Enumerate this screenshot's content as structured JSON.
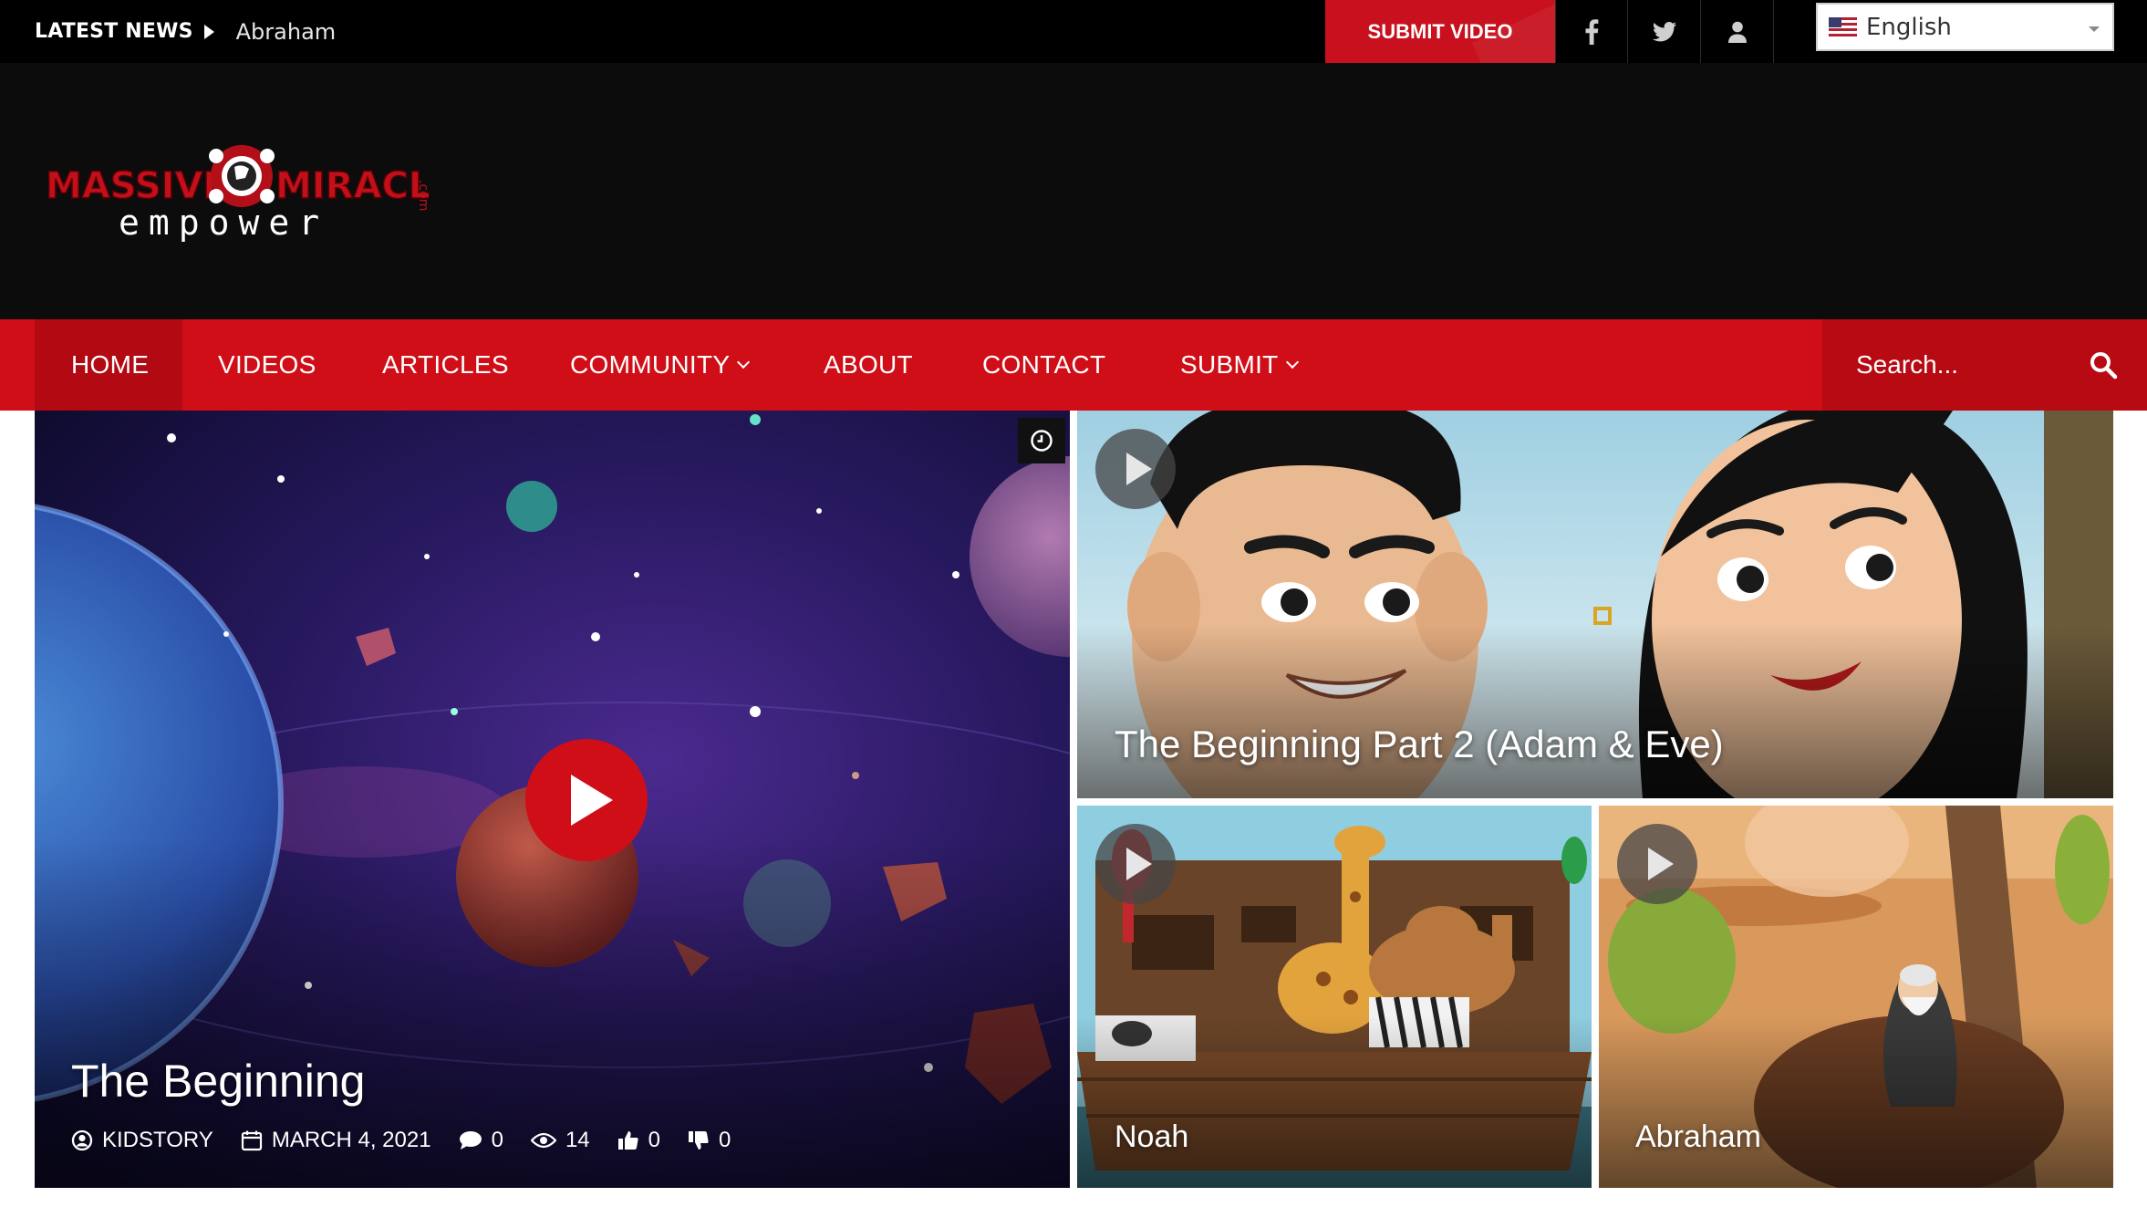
{
  "topbar": {
    "latest_label": "LATEST NEWS",
    "latest_item": "Abraham",
    "submit_video": "SUBMIT VIDEO",
    "social": [
      "facebook-icon",
      "twitter-icon",
      "user-icon"
    ],
    "language": "English"
  },
  "logo": {
    "word_left": "MASSIVE",
    "word_right": "MIRACLE",
    "tld": ".com",
    "tagline": "empower"
  },
  "nav": {
    "items": [
      {
        "label": "HOME",
        "active": true
      },
      {
        "label": "VIDEOS"
      },
      {
        "label": "ARTICLES"
      },
      {
        "label": "COMMUNITY",
        "dropdown": true
      },
      {
        "label": "ABOUT"
      },
      {
        "label": "CONTACT"
      },
      {
        "label": "SUBMIT",
        "dropdown": true
      }
    ],
    "search_placeholder": "Search..."
  },
  "featured": {
    "title": "The Beginning",
    "author": "KIDSTORY",
    "date": "MARCH 4, 2021",
    "comments": "0",
    "views": "14",
    "likes": "0",
    "dislikes": "0"
  },
  "tiles": [
    {
      "title": "The Beginning Part 2 (Adam & Eve)"
    },
    {
      "title": "Noah"
    },
    {
      "title": "Abraham"
    }
  ],
  "colors": {
    "brand_red": "#d00e18",
    "topbar_bg": "#000000",
    "header_bg": "#0c0c0c"
  }
}
